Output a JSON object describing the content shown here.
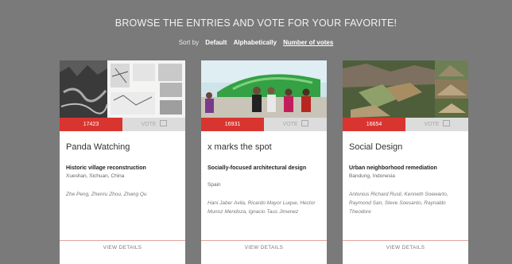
{
  "header": {
    "title": "BROWSE THE ENTRIES AND VOTE FOR YOUR FAVORITE!",
    "sort_label": "Sort by",
    "sort_options": [
      "Default",
      "Alphabetically",
      "Number of votes"
    ],
    "active_sort": "Number of votes"
  },
  "cards": [
    {
      "votes": "17423",
      "vote_label": "VOTE",
      "title": "Panda Watching",
      "subtitle": "Historic village reconstruction",
      "location": "Xueshan, Sichuan, China",
      "authors": "Zhe Peng, Zhenru Zhou, Zhang Qu",
      "details_label": "VIEW DETAILS"
    },
    {
      "votes": "16931",
      "vote_label": "VOTE",
      "title": "x marks the spot",
      "subtitle": "Socially-focused architectural design",
      "location": "Spain",
      "authors": "Hani Jaber Avila, Ricardo Mayor Luque, Hector Munoz Mendoza, Ignacio Taus Jimenez",
      "details_label": "VIEW DETAILS"
    },
    {
      "votes": "16654",
      "vote_label": "VOTE",
      "title": "Social Design",
      "subtitle": "Urban neighborhood remediation",
      "location": "Bandung, Indonesia",
      "authors": "Antonius Richard Rusli, Kenneth Soewarto, Raymond San, Steve Soesanto, Raynaldo Theodore",
      "details_label": "VIEW DETAILS"
    }
  ],
  "colors": {
    "background": "#7a7a7a",
    "accent": "#d93530",
    "card": "#ffffff"
  }
}
